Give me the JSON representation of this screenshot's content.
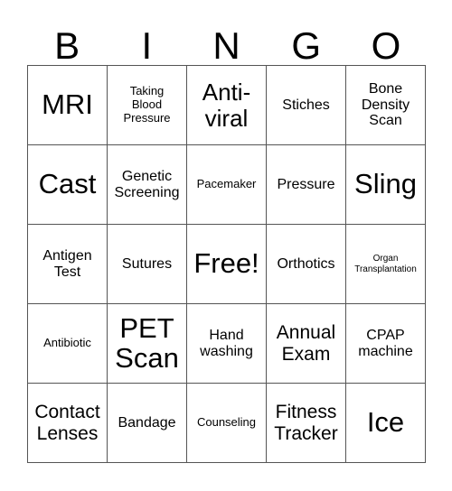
{
  "card": {
    "headers": [
      "B",
      "I",
      "N",
      "G",
      "O"
    ],
    "free_space_index": 12,
    "colors": {
      "background": "#ffffff",
      "text": "#000000",
      "border": "#555555"
    },
    "cells": [
      {
        "text": "MRI",
        "size": "xxl"
      },
      {
        "text": "Taking\nBlood\nPressure",
        "size": "sm"
      },
      {
        "text": "Anti-\nviral",
        "size": "xl"
      },
      {
        "text": "Stiches",
        "size": "md"
      },
      {
        "text": "Bone\nDensity\nScan",
        "size": "md"
      },
      {
        "text": "Cast",
        "size": "xxl"
      },
      {
        "text": "Genetic\nScreening",
        "size": "md"
      },
      {
        "text": "Pacemaker",
        "size": "sm"
      },
      {
        "text": "Pressure",
        "size": "md"
      },
      {
        "text": "Sling",
        "size": "xxl"
      },
      {
        "text": "Antigen\nTest",
        "size": "md"
      },
      {
        "text": "Sutures",
        "size": "md"
      },
      {
        "text": "Free!",
        "size": "xxl"
      },
      {
        "text": "Orthotics",
        "size": "md"
      },
      {
        "text": "Organ\nTransplantation",
        "size": "xs"
      },
      {
        "text": "Antibiotic",
        "size": "sm"
      },
      {
        "text": "PET\nScan",
        "size": "xxl"
      },
      {
        "text": "Hand\nwashing",
        "size": "md"
      },
      {
        "text": "Annual\nExam",
        "size": "lg"
      },
      {
        "text": "CPAP\nmachine",
        "size": "md"
      },
      {
        "text": "Contact\nLenses",
        "size": "lg"
      },
      {
        "text": "Bandage",
        "size": "md"
      },
      {
        "text": "Counseling",
        "size": "sm"
      },
      {
        "text": "Fitness\nTracker",
        "size": "lg"
      },
      {
        "text": "Ice",
        "size": "xxl"
      }
    ]
  }
}
